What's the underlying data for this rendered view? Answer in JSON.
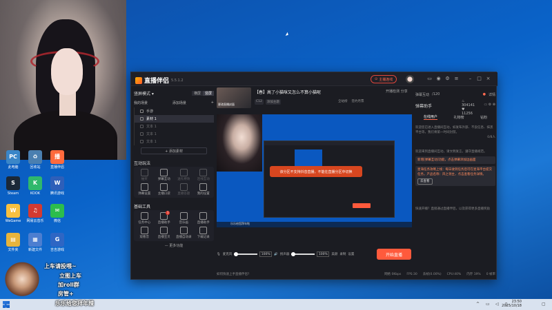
{
  "desktop": {
    "icons": [
      {
        "label": "此电脑",
        "color": "#3a86c8",
        "glyph": "PC"
      },
      {
        "label": "回收站",
        "color": "#4a7fb0",
        "glyph": "♻"
      },
      {
        "label": "直播伴侣",
        "color": "#ff6a3d",
        "glyph": "播"
      },
      {
        "label": "Steam",
        "color": "#1b2838",
        "glyph": "S"
      },
      {
        "label": "KOOK",
        "color": "#2fb86c",
        "glyph": "K"
      },
      {
        "label": "腾讯游戏",
        "color": "#2e5fb9",
        "glyph": "W"
      },
      {
        "label": "WeGame",
        "color": "#f7c040",
        "glyph": "W"
      },
      {
        "label": "网易云音乐",
        "color": "#d33a31",
        "glyph": "♫"
      },
      {
        "label": "微信",
        "color": "#2cbd4c",
        "glyph": "✉"
      },
      {
        "label": "文件夹",
        "color": "#e7b43c",
        "glyph": "▤"
      },
      {
        "label": "新建文件",
        "color": "#4c7ed0",
        "glyph": "▦"
      },
      {
        "label": "吉吉游戏",
        "color": "#2e66c4",
        "glyph": "G"
      }
    ]
  },
  "app": {
    "name": "直播伴侣",
    "version": "5.5.1.2",
    "live_status_button": "主播连线",
    "left": {
      "mode_label": "竖屏模式",
      "seg": [
        "横屏",
        "竖屏"
      ],
      "scene_tabs": [
        "我的场景",
        "添加场景"
      ],
      "scenes": [
        "手游",
        "素材 1",
        "文本 1",
        "文本 1",
        "文本 1"
      ],
      "add_source": "+ 添加素材",
      "interaction_title": "互动玩法",
      "interaction_items": [
        "抽奖",
        "弹幕互动",
        "送礼特效",
        "连线互动",
        "弹幕设置",
        "主播口袋",
        "直播答题",
        "我的设置"
      ],
      "tools_title": "基础工具",
      "tools_items": [
        "任务中心",
        "直播助手",
        "音乐画",
        "直播助手",
        "观看音",
        "直播宝贝",
        "直播自动录",
        "下载记录"
      ],
      "tools_badge": "1",
      "more": "— 更多功能"
    },
    "stream": {
      "thumb_label": "更改直播封面",
      "title": "【春】高了小猫咪又怎么不算小猫呢",
      "tags": [
        "C12",
        "添加主题"
      ],
      "stats": [
        "全站榜",
        "签约月票"
      ],
      "viewers": "304141",
      "likes": "11256",
      "share": "分享",
      "check": "开播检测",
      "fans": "弹幕互动",
      "count": "/120",
      "details": "详情"
    },
    "canvas": {
      "toast": "该分区不支持抖音直播，不能在直播分区中切换",
      "mini_taskbar": "乐乐给您拜年啦"
    },
    "controls": {
      "mic_label": "麦克风",
      "mic_pct": "100%",
      "speaker_label": "扬声器",
      "speaker_pct": "100%",
      "effects": "美颜",
      "record": "录制",
      "settings": "设置",
      "start_button": "开始直播"
    },
    "status": {
      "help": "如何快速上手直播伴侣?",
      "stats": "网络 0Kbps",
      "fps": "FPS:30",
      "drop": "丢帧(0.00%)",
      "cpu": "CPU:40%",
      "mem": "内存 19%",
      "rate": "0 帧率"
    },
    "right": {
      "title": "弹幕助手",
      "tabs": [
        "在线用户",
        "礼物榜",
        "钻粉"
      ],
      "note1": "欢迎您已进入直播间互动，如发布外部、不良信息、抹黑平台等，我们将第一时间封禁。",
      "count": "0/8人",
      "note2": "欢迎来到直播间互动，请文明发言，遵守直播规范。",
      "chat1": "新增[弹幕互动]功能，点击弹幕添加边画面",
      "chat2": "星海任务攻略上线：每日收到任务后可在星海平台提交任务，产品名称：风之领主，点击查看任务详情。",
      "view_btn": "去查看",
      "note3": "快速开播？直接通过直播伴侣，以及获得更多直播奖励"
    }
  },
  "overlay": {
    "line1": "上车请投喂~",
    "line2": "立图上车",
    "line3": "加roll群",
    "line4": "房管+",
    "line5": "乐乐给您拜年辣"
  },
  "taskbar": {
    "time": "23:50",
    "date": "2025/10/18"
  }
}
